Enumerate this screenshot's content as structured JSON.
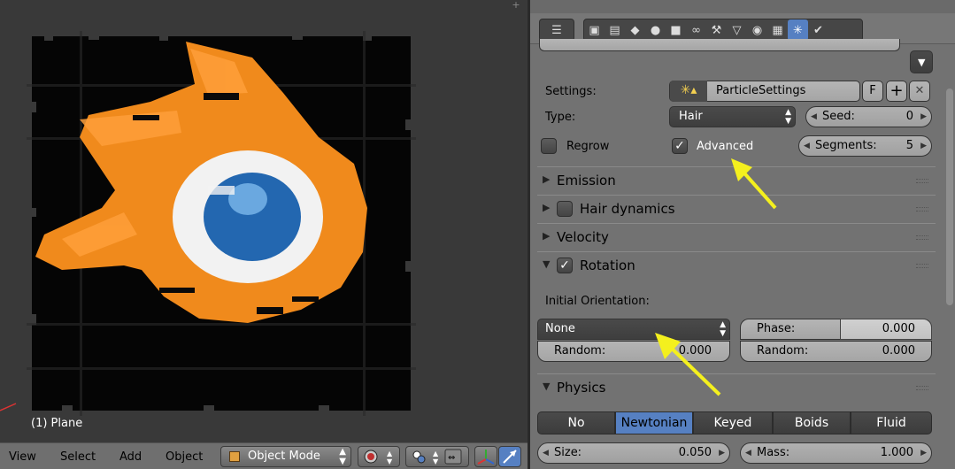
{
  "viewport": {
    "object_label": "(1) Plane",
    "corner_symbol": "+"
  },
  "viewport_header": {
    "menus": [
      "View",
      "Select",
      "Add",
      "Object"
    ],
    "mode": "Object Mode"
  },
  "properties": {
    "settings_label": "Settings:",
    "settings_value": "ParticleSettings",
    "fake_user": "F",
    "type_label": "Type:",
    "type_value": "Hair",
    "seed_label": "Seed:",
    "seed_value": "0",
    "regrow_label": "Regrow",
    "regrow_checked": false,
    "advanced_label": "Advanced",
    "advanced_checked": true,
    "segments_label": "Segments:",
    "segments_value": "5",
    "panels": {
      "emission": "Emission",
      "hair_dynamics": "Hair dynamics",
      "velocity": "Velocity",
      "rotation": "Rotation",
      "physics": "Physics"
    },
    "initial_orientation_label": "Initial Orientation:",
    "orientation_value": "None",
    "random_label": "Random:",
    "random_value": "0.000",
    "phase_label": "Phase:",
    "phase_value": "0.000",
    "phase_random_label": "Random:",
    "phase_random_value": "0.000",
    "physics_types": [
      "No",
      "Newtonian",
      "Keyed",
      "Boids",
      "Fluid"
    ],
    "physics_active": "Newtonian",
    "size_label": "Size:",
    "size_value": "0.050",
    "mass_label": "Mass:",
    "mass_value": "1.000"
  },
  "colors": {
    "accent": "#5680c2",
    "annotation_arrow": "#f4f01e",
    "panel_bg": "#727272",
    "viewport_bg": "#393939"
  }
}
